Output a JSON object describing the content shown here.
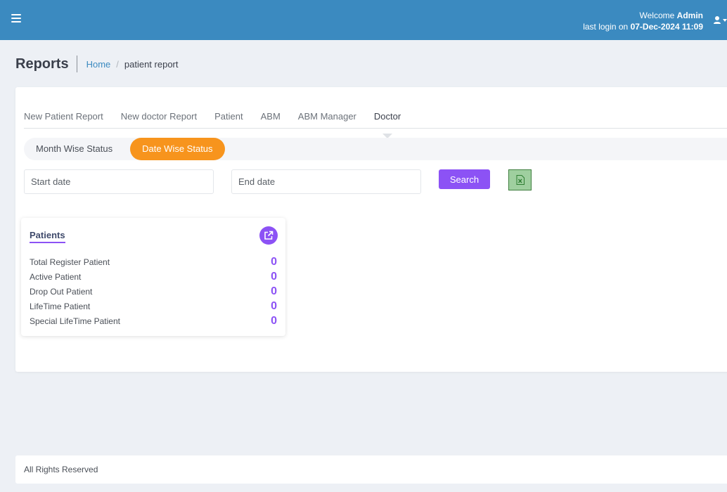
{
  "header": {
    "welcome_prefix": "Welcome",
    "user_name": "Admin",
    "last_login_prefix": "last login on",
    "last_login": "07-Dec-2024 11:09",
    "menu_icon": "hamburger-icon",
    "user_icon": "user-icon",
    "bar_color": "#3b8ac0"
  },
  "page": {
    "title": "Reports",
    "breadcrumb": {
      "home": "Home",
      "separator": "/",
      "current": "patient report"
    }
  },
  "tabs": [
    {
      "label": "New Patient Report",
      "active": false
    },
    {
      "label": "New doctor Report",
      "active": false
    },
    {
      "label": "Patient",
      "active": false
    },
    {
      "label": "ABM",
      "active": false
    },
    {
      "label": "ABM Manager",
      "active": false
    },
    {
      "label": "Doctor",
      "active": true
    }
  ],
  "subtabs": [
    {
      "label": "Month Wise Status",
      "active": false
    },
    {
      "label": "Date Wise Status",
      "active": true
    }
  ],
  "filters": {
    "start_date": {
      "placeholder": "Start date",
      "value": ""
    },
    "end_date": {
      "placeholder": "End date",
      "value": ""
    },
    "search_label": "Search",
    "export_icon": "excel-icon"
  },
  "stats": {
    "title": "Patients",
    "open_icon": "external-link-icon",
    "rows": [
      {
        "label": "Total Register Patient",
        "value": "0"
      },
      {
        "label": "Active Patient",
        "value": "0"
      },
      {
        "label": "Drop Out Patient",
        "value": "0"
      },
      {
        "label": "LifeTime Patient",
        "value": "0"
      },
      {
        "label": "Special LifeTime Patient",
        "value": "0"
      }
    ]
  },
  "footer": {
    "text": "All Rights Reserved"
  },
  "colors": {
    "accent": "#8c52f5",
    "active_subtab": "#f7941d",
    "link": "#3b8ac0",
    "excel": "#9fcf9f"
  }
}
